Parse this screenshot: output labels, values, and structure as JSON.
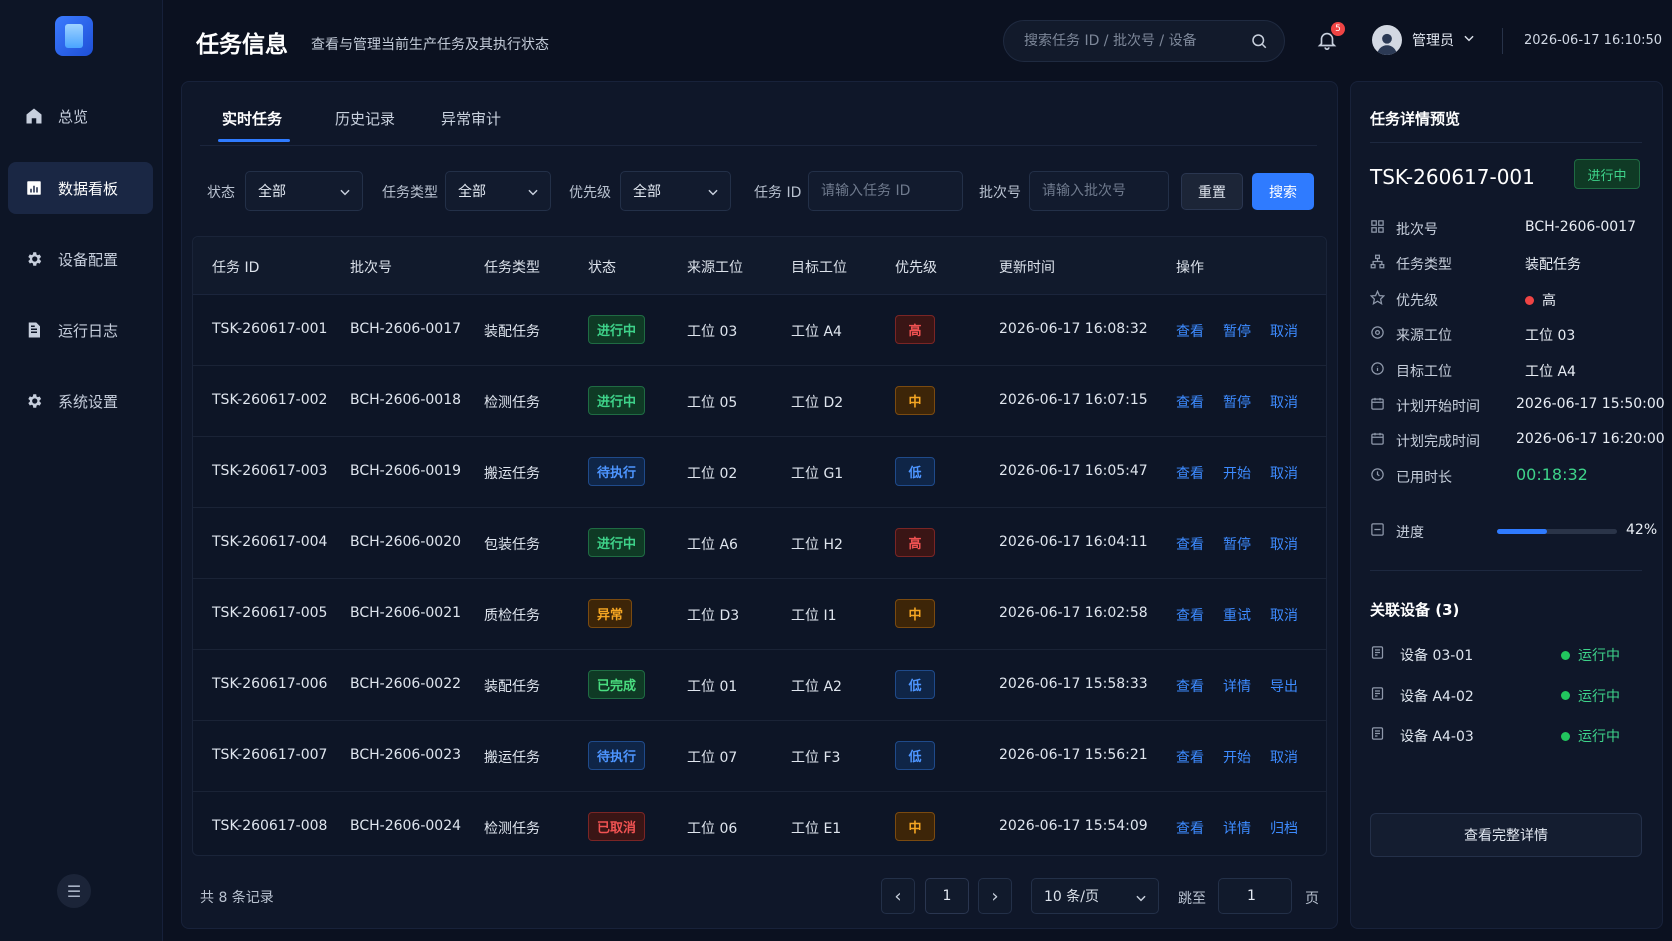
{
  "sidebar": {
    "items": [
      {
        "label": "总览",
        "icon": "home-icon"
      },
      {
        "label": "数据看板",
        "icon": "chart-icon",
        "active": true
      },
      {
        "label": "设备配置",
        "icon": "gear-icon"
      },
      {
        "label": "运行日志",
        "icon": "document-icon"
      },
      {
        "label": "系统设置",
        "icon": "gear-icon"
      }
    ],
    "menu_toggle": "☰"
  },
  "header": {
    "title": "任务信息",
    "subtitle": "查看与管理当前生产任务及其执行状态",
    "search_placeholder": "搜索任务 ID / 批次号 / 设备",
    "notification_count": "5",
    "user_name": "管理员",
    "datetime": "2026-06-17 16:10:50"
  },
  "tabs": [
    {
      "label": "实时任务",
      "active": true
    },
    {
      "label": "历史记录"
    },
    {
      "label": "异常审计"
    }
  ],
  "filters": {
    "status_label": "状态",
    "status_value": "全部",
    "type_label": "任务类型",
    "type_value": "全部",
    "priority_label": "优先级",
    "priority_value": "全部",
    "task_id_label": "任务 ID",
    "task_id_placeholder": "请输入任务 ID",
    "batch_label": "批次号",
    "batch_placeholder": "请输入批次号",
    "reset_label": "重置",
    "search_label": "搜索"
  },
  "table": {
    "columns": [
      "任务 ID",
      "批次号",
      "任务类型",
      "状态",
      "来源工位",
      "目标工位",
      "优先级",
      "更新时间",
      "操作"
    ],
    "rows": [
      {
        "id": "TSK-260617-001",
        "batch": "BCH-2606-0017",
        "type": "装配任务",
        "status": "进行中",
        "status_kind": "running",
        "source": "工位 03",
        "target": "工位 A4",
        "priority": "高",
        "priority_kind": "high",
        "updated": "2026-06-17 16:08:32",
        "actions": [
          "查看",
          "暂停",
          "取消"
        ]
      },
      {
        "id": "TSK-260617-002",
        "batch": "BCH-2606-0018",
        "type": "检测任务",
        "status": "进行中",
        "status_kind": "running",
        "source": "工位 05",
        "target": "工位 D2",
        "priority": "中",
        "priority_kind": "mid",
        "updated": "2026-06-17 16:07:15",
        "actions": [
          "查看",
          "暂停",
          "取消"
        ]
      },
      {
        "id": "TSK-260617-003",
        "batch": "BCH-2606-0019",
        "type": "搬运任务",
        "status": "待执行",
        "status_kind": "pending",
        "source": "工位 02",
        "target": "工位 G1",
        "priority": "低",
        "priority_kind": "low",
        "updated": "2026-06-17 16:05:47",
        "actions": [
          "查看",
          "开始",
          "取消"
        ]
      },
      {
        "id": "TSK-260617-004",
        "batch": "BCH-2606-0020",
        "type": "包装任务",
        "status": "进行中",
        "status_kind": "running",
        "source": "工位 A6",
        "target": "工位 H2",
        "priority": "高",
        "priority_kind": "high",
        "updated": "2026-06-17 16:04:11",
        "actions": [
          "查看",
          "暂停",
          "取消"
        ]
      },
      {
        "id": "TSK-260617-005",
        "batch": "BCH-2606-0021",
        "type": "质检任务",
        "status": "异常",
        "status_kind": "error",
        "source": "工位 D3",
        "target": "工位 I1",
        "priority": "中",
        "priority_kind": "mid",
        "updated": "2026-06-17 16:02:58",
        "actions": [
          "查看",
          "重试",
          "取消"
        ]
      },
      {
        "id": "TSK-260617-006",
        "batch": "BCH-2606-0022",
        "type": "装配任务",
        "status": "已完成",
        "status_kind": "done",
        "source": "工位 01",
        "target": "工位 A2",
        "priority": "低",
        "priority_kind": "low",
        "updated": "2026-06-17 15:58:33",
        "actions": [
          "查看",
          "详情",
          "导出"
        ]
      },
      {
        "id": "TSK-260617-007",
        "batch": "BCH-2606-0023",
        "type": "搬运任务",
        "status": "待执行",
        "status_kind": "pending",
        "source": "工位 07",
        "target": "工位 F3",
        "priority": "低",
        "priority_kind": "low",
        "updated": "2026-06-17 15:56:21",
        "actions": [
          "查看",
          "开始",
          "取消"
        ]
      },
      {
        "id": "TSK-260617-008",
        "batch": "BCH-2606-0024",
        "type": "检测任务",
        "status": "已取消",
        "status_kind": "cancelled",
        "source": "工位 06",
        "target": "工位 E1",
        "priority": "中",
        "priority_kind": "mid",
        "updated": "2026-06-17 15:54:09",
        "actions": [
          "查看",
          "详情",
          "归档"
        ]
      }
    ]
  },
  "pagination": {
    "total": "共 8 条记录",
    "current_page": "1",
    "page_size": "10 条/页",
    "jump_label": "跳至",
    "jump_value": "1",
    "page_suffix": "页",
    "prev": "‹",
    "next": "›"
  },
  "detail": {
    "title": "任务详情预览",
    "task_id": "TSK-260617-001",
    "status": "进行中",
    "fields": [
      {
        "label": "批次号",
        "value": "BCH-2606-0017",
        "icon": "grid-icon"
      },
      {
        "label": "任务类型",
        "value": "装配任务",
        "icon": "sitemap-icon"
      },
      {
        "label": "优先级",
        "value": "高",
        "icon": "star-icon"
      },
      {
        "label": "来源工位",
        "value": "工位 03",
        "icon": "target-icon"
      },
      {
        "label": "目标工位",
        "value": "工位 A4",
        "icon": "info-icon"
      },
      {
        "label": "计划开始时间",
        "value": "2026-06-17 15:50:00",
        "icon": "calendar-icon"
      },
      {
        "label": "计划完成时间",
        "value": "2026-06-17 16:20:00",
        "icon": "calendar-icon"
      },
      {
        "label": "已用时长",
        "value": "00:18:32",
        "icon": "clock-icon"
      }
    ],
    "progress_label": "进度",
    "progress_value": 42,
    "progress_text": "42%",
    "devices_title": "关联设备 (3)",
    "devices": [
      {
        "name": "设备 03-01",
        "status": "运行中"
      },
      {
        "name": "设备 A4-02",
        "status": "运行中"
      },
      {
        "name": "设备 A4-03",
        "status": "运行中"
      }
    ],
    "view_full_label": "查看完整详情"
  },
  "colors": {
    "accent": "#2f7bff",
    "running": "#3ed38a",
    "error": "#ef4444",
    "warning": "#f59e0b"
  }
}
